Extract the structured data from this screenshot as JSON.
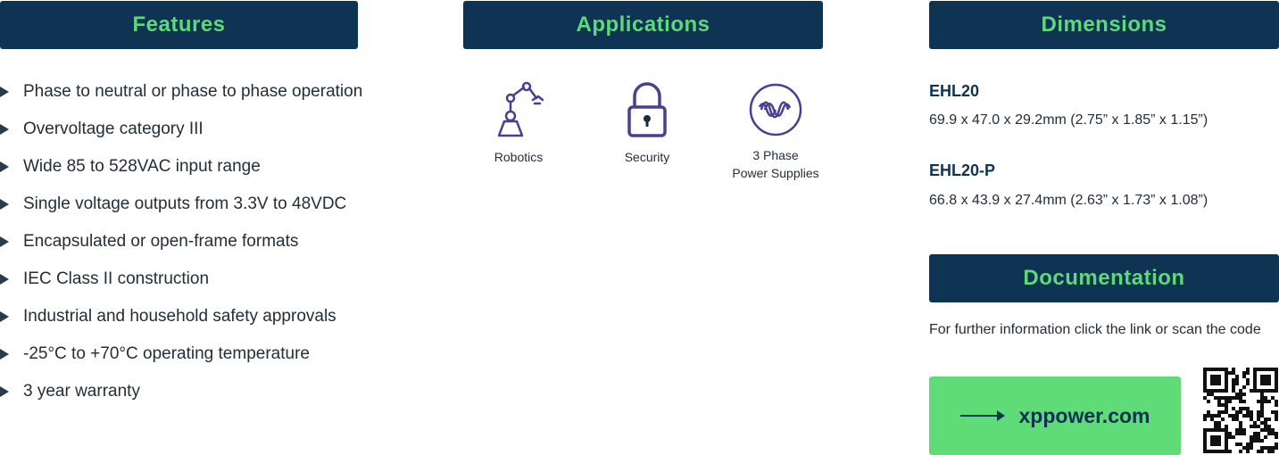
{
  "features": {
    "title": "Features",
    "items": [
      "Phase to neutral or phase to phase operation",
      "Overvoltage category III",
      "Wide 85 to 528VAC input range",
      "Single voltage outputs from 3.3V to 48VDC",
      "Encapsulated or open-frame formats",
      "IEC Class II construction",
      "Industrial and household safety approvals",
      "-25°C to +70°C operating temperature",
      "3 year warranty"
    ]
  },
  "applications": {
    "title": "Applications",
    "items": [
      {
        "icon": "robot-arm-icon",
        "label": "Robotics"
      },
      {
        "icon": "padlock-icon",
        "label": "Security"
      },
      {
        "icon": "three-phase-wave-icon",
        "label_line1": "3 Phase",
        "label_line2": "Power Supplies"
      }
    ]
  },
  "dimensions": {
    "title": "Dimensions",
    "models": [
      {
        "name": "EHL20",
        "size": "69.9 x 47.0 x 29.2mm (2.75” x 1.85” x 1.15”)"
      },
      {
        "name": "EHL20-P",
        "size": "66.8 x 43.9 x 27.4mm (2.63” x 1.73” x 1.08”)"
      }
    ]
  },
  "documentation": {
    "title": "Documentation",
    "text": "For further information click the link or scan the code",
    "link_label": "xppower.com",
    "qr_icon": "qr-code-icon"
  },
  "colors": {
    "header_bg": "#0f3353",
    "header_text": "#5ed879",
    "accent_green": "#5fdc78",
    "icon_purple": "#4b3f8f"
  }
}
